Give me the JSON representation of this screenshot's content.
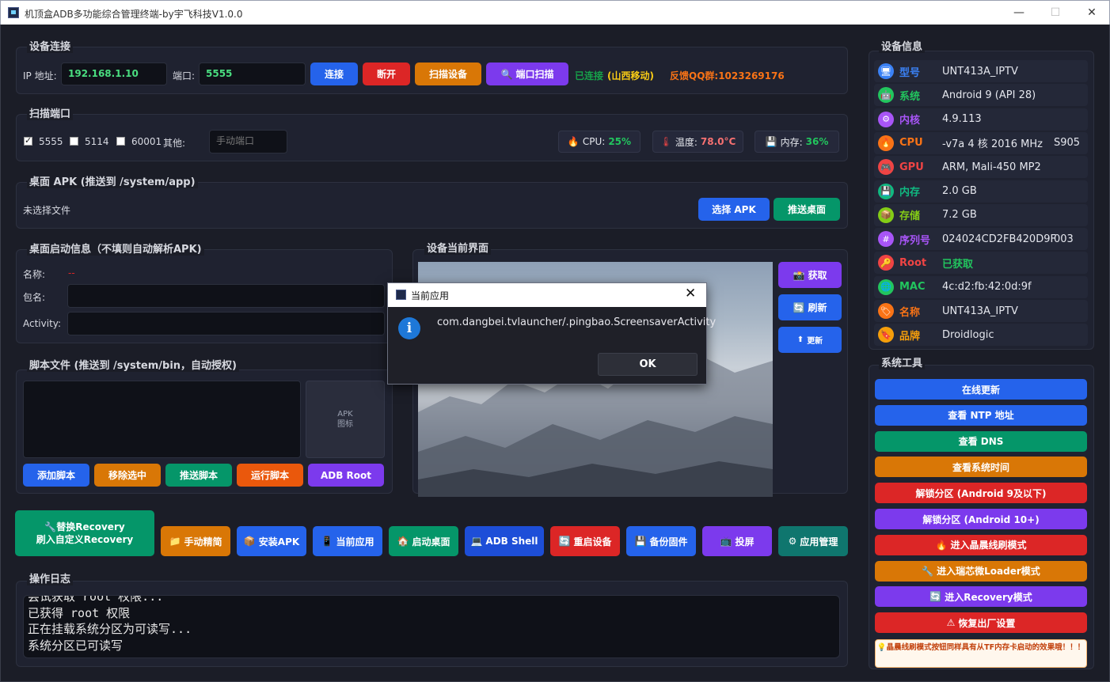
{
  "window": {
    "title": "机顶盒ADB多功能综合管理终端-by宇飞科技V1.0.0",
    "minimize": "—",
    "maximize": "☐",
    "close": "✕"
  },
  "conn": {
    "title": "设备连接",
    "ip_label": "IP 地址:",
    "ip_value": "192.168.1.10",
    "port_label": "端口:",
    "port_value": "5555",
    "btn_connect": "连接",
    "btn_disconnect": "断开",
    "btn_scan_dev": "扫描设备",
    "btn_port_scan": "端口扫描",
    "status": "已连接",
    "isp": "(山西移动)",
    "qq": "反馈QQ群:1023269176"
  },
  "scan": {
    "title": "扫描端口",
    "p1": "5555",
    "p2": "5114",
    "p3": "60001",
    "other": "其他:",
    "manual_placeholder": "手动端口",
    "cpu_label": "CPU:",
    "cpu_value": "25%",
    "temp_label": "温度:",
    "temp_value": "78.0°C",
    "mem_label": "内存:",
    "mem_value": "36%"
  },
  "apk": {
    "title": "桌面 APK (推送到 /system/app)",
    "file_status": "未选择文件",
    "btn_select": "选择 APK",
    "btn_push": "推送桌面"
  },
  "launch": {
    "title": "桌面启动信息（不填则自动解析APK)",
    "name_label": "名称:",
    "name_value": "--",
    "pkg_label": "包名:",
    "activity_label": "Activity:"
  },
  "script": {
    "title": "脚本文件 (推送到 /system/bin，自动授权)",
    "apk_icon_1": "APK",
    "apk_icon_2": "图标",
    "btn_add": "添加脚本",
    "btn_remove": "移除选中",
    "btn_push": "推送脚本",
    "btn_run": "运行脚本",
    "btn_root": "ADB Root"
  },
  "screen": {
    "title": "设备当前界面",
    "btn_get": "获取",
    "btn_refresh": "刷新",
    "btn_update": "更新"
  },
  "actions": {
    "recovery_1": "替换Recovery",
    "recovery_2": "刷入自定义Recovery",
    "manual": "手动精简",
    "install": "安装APK",
    "current_app": "当前应用",
    "launch_desktop": "启动桌面",
    "shell": "ADB Shell",
    "reboot": "重启设备",
    "backup": "备份固件",
    "cast": "投屏",
    "app_manage": "应用管理"
  },
  "log": {
    "title": "操作日志",
    "lines": [
      "尝试获取 root 权限...",
      "已获得 root 权限",
      "正在挂载系统分区为可读写...",
      "系统分区已可读写"
    ]
  },
  "devinfo": {
    "title": "设备信息",
    "rows": [
      {
        "key": "型号",
        "value": "UNT413A_IPTV",
        "color": "#3b82f6",
        "icon": "monitor-icon"
      },
      {
        "key": "系统",
        "value": "Android 9 (API 28)",
        "color": "#22c55e",
        "icon": "android-icon"
      },
      {
        "key": "内核",
        "value": "4.9.113",
        "color": "#a855f7",
        "icon": "gear-icon"
      },
      {
        "key": "CPU",
        "value": "-v7a 4 核 2016 MHz",
        "value2": "S905",
        "color": "#f97316",
        "icon": "fire-icon"
      },
      {
        "key": "GPU",
        "value": "ARM, Mali-450 MP2",
        "color": "#ef4444",
        "icon": "gamepad-icon"
      },
      {
        "key": "内存",
        "value": "2.0 GB",
        "color": "#10b981",
        "icon": "memory-icon"
      },
      {
        "key": "存储",
        "value": "7.2 GB",
        "color": "#84cc16",
        "icon": "storage-icon"
      },
      {
        "key": "序列号",
        "value": "024024CD2FB420D9F",
        "value2": "003",
        "color": "#a855f7",
        "icon": "hash-icon"
      },
      {
        "key": "Root",
        "value": "已获取",
        "color": "#ef4444",
        "vcolor": "#22c55e",
        "icon": "key-icon"
      },
      {
        "key": "MAC",
        "value": "4c:d2:fb:42:0d:9f",
        "color": "#22c55e",
        "icon": "network-icon"
      },
      {
        "key": "名称",
        "value": "UNT413A_IPTV",
        "color": "#f97316",
        "icon": "tag-icon"
      },
      {
        "key": "品牌",
        "value": "Droidlogic",
        "color": "#f59e0b",
        "icon": "label-icon"
      }
    ]
  },
  "tools": {
    "title": "系统工具",
    "items": [
      {
        "label": "在线更新",
        "color": "#2563eb"
      },
      {
        "label": "查看 NTP 地址",
        "color": "#2563eb"
      },
      {
        "label": "查看 DNS",
        "color": "#059669"
      },
      {
        "label": "查看系统时间",
        "color": "#d97706"
      },
      {
        "label": "解锁分区 (Android 9及以下)",
        "color": "#dc2626"
      },
      {
        "label": "解锁分区 (Android 10+)",
        "color": "#7c3aed"
      },
      {
        "label": "进入晶晨线刷模式",
        "color": "#dc2626",
        "icon": "🔥"
      },
      {
        "label": "进入瑞芯微Loader模式",
        "color": "#d97706",
        "icon": "🔧"
      },
      {
        "label": "进入Recovery模式",
        "color": "#7c3aed",
        "icon": "🔄"
      },
      {
        "label": "恢复出厂设置",
        "color": "#dc2626",
        "icon": "⚠"
      }
    ],
    "warning": "晶晨线刷模式按钮同样具有从TF内存卡启动的效果哦！！！"
  },
  "dialog": {
    "title": "当前应用",
    "message": "com.dangbei.tvlauncher/.pingbao.ScreensaverActivity",
    "ok": "OK"
  }
}
